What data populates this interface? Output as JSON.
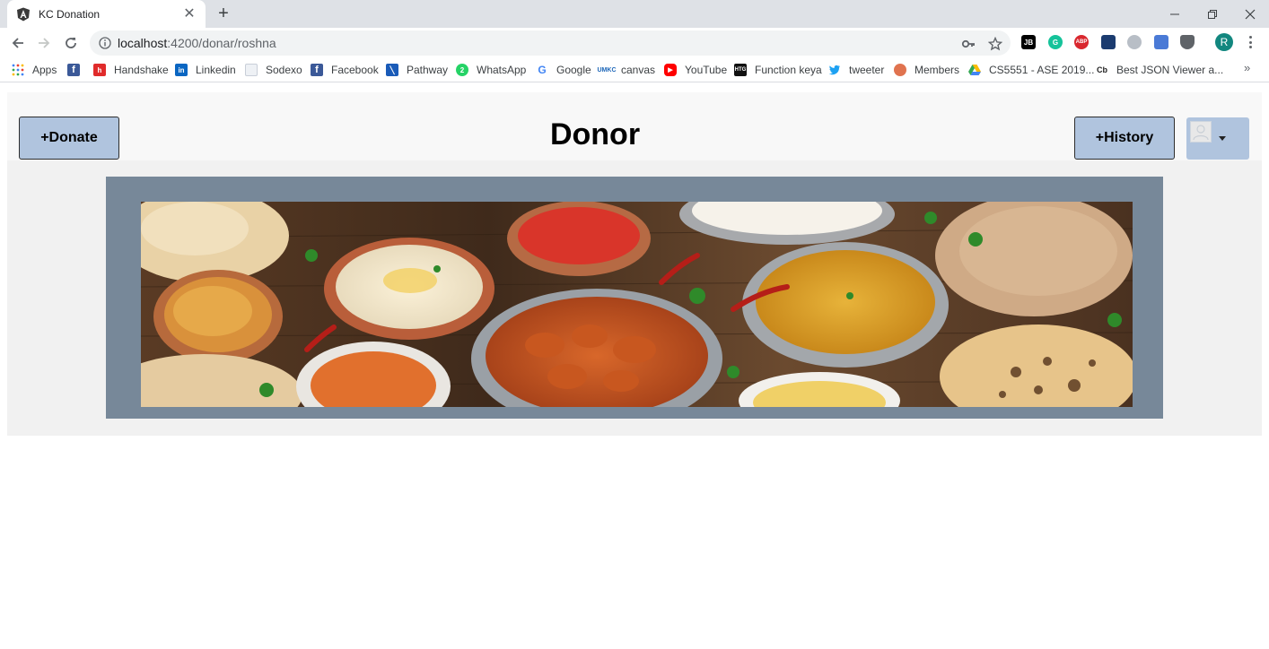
{
  "browser": {
    "tab_title": "KC Donation",
    "url_host": "localhost",
    "url_path": ":4200/donar/roshna",
    "profile_initial": "R",
    "bookmarks": [
      {
        "label": "Apps",
        "icon": "apps-grid-icon"
      },
      {
        "label": "",
        "icon": "facebook-icon"
      },
      {
        "label": "Handshake",
        "icon": "handshake-icon"
      },
      {
        "label": "Linkedin",
        "icon": "linkedin-icon"
      },
      {
        "label": "Sodexo",
        "icon": "sodexo-icon"
      },
      {
        "label": "Facebook",
        "icon": "facebook-icon"
      },
      {
        "label": "Pathway",
        "icon": "pathway-icon"
      },
      {
        "label": "WhatsApp",
        "icon": "whatsapp-icon"
      },
      {
        "label": "Google",
        "icon": "google-icon"
      },
      {
        "label": "canvas",
        "icon": "umkc-icon"
      },
      {
        "label": "YouTube",
        "icon": "youtube-icon"
      },
      {
        "label": "Function keya",
        "icon": "htg-icon"
      },
      {
        "label": "tweeter",
        "icon": "twitter-icon"
      },
      {
        "label": "Members",
        "icon": "members-icon"
      },
      {
        "label": "CS5551 - ASE 2019...",
        "icon": "google-drive-icon"
      },
      {
        "label": "Best JSON Viewer a...",
        "icon": "codebeautify-icon"
      }
    ],
    "ext_labels": {
      "jb": "JB",
      "abp": "ABP",
      "g": "G",
      "cb": "Cb",
      "htg": "HTG"
    },
    "colors": {
      "tabstrip": "#dee1e6",
      "omnibox": "#f1f3f4",
      "profile": "#12877f"
    }
  },
  "app": {
    "donate_label": "+Donate",
    "title": "Donor",
    "history_label": "+History",
    "colors": {
      "button": "#b0c4de",
      "banner": "#778899",
      "panel": "#f1f1f1",
      "header": "#f8f8f8"
    }
  }
}
